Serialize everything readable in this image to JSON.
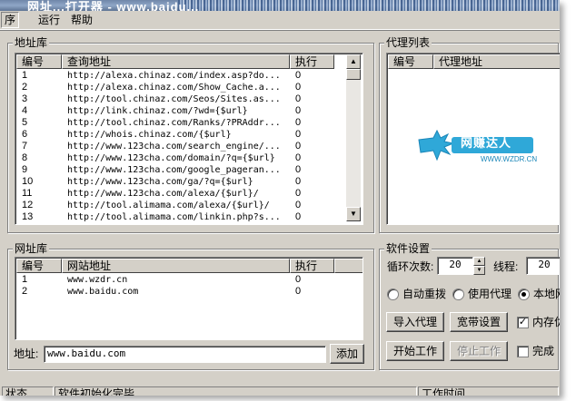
{
  "window": {
    "title": "网址...打开器 - www.baidu..."
  },
  "menu": [
    "序",
    "运行",
    "帮助"
  ],
  "address_library": {
    "group_label": "地址库",
    "columns": [
      "编号",
      "查询地址",
      "执行"
    ],
    "rows": [
      [
        "1",
        "http://alexa.chinaz.com/index.asp?do...",
        "0"
      ],
      [
        "2",
        "http://alexa.chinaz.com/Show_Cache.a...",
        "0"
      ],
      [
        "3",
        "http://tool.chinaz.com/Seos/Sites.as...",
        "0"
      ],
      [
        "4",
        "http://link.chinaz.com/?wd={$url}",
        "0"
      ],
      [
        "5",
        "http://tool.chinaz.com/Ranks/?PRAddr...",
        "0"
      ],
      [
        "6",
        "http://whois.chinaz.com/{$url}",
        "0"
      ],
      [
        "7",
        "http://www.123cha.com/search_engine/...",
        "0"
      ],
      [
        "8",
        "http://www.123cha.com/domain/?q={$url}",
        "0"
      ],
      [
        "9",
        "http://www.123cha.com/google_pageran...",
        "0"
      ],
      [
        "10",
        "http://www.123cha.com/ga/?q={$url}",
        "0"
      ],
      [
        "11",
        "http://www.123cha.com/alexa/{$url}/",
        "0"
      ],
      [
        "12",
        "http://tool.alimama.com/alexa/{$url}/",
        "0"
      ],
      [
        "13",
        "http://tool.alimama.com/linkin.php?s...",
        "0"
      ]
    ]
  },
  "proxy_list": {
    "group_label": "代理列表",
    "columns": [
      "编号",
      "代理地址"
    ],
    "logo_text": "网赚达人",
    "logo_sub": "WWW.WZDR.CN"
  },
  "url_library": {
    "group_label": "网址库",
    "columns": [
      "编号",
      "网站地址",
      "执行"
    ],
    "rows": [
      [
        "1",
        "www.wzdr.cn",
        "0"
      ],
      [
        "2",
        "www.baidu.com",
        "0"
      ]
    ],
    "address_label": "地址:",
    "address_value": "www.baidu.com",
    "add_button": "添加"
  },
  "settings": {
    "group_label": "软件设置",
    "loop_label": "循环次数:",
    "loop_value": "20",
    "thread_label": "线程:",
    "thread_value": "20",
    "radio_auto_redial": "自动重拨",
    "radio_use_proxy": "使用代理",
    "radio_local": "本地网",
    "selected_radio": "local",
    "import_proxy": "导入代理",
    "broadband_settings": "宽带设置",
    "memory_opt": "内存优化",
    "memory_opt_checked": true,
    "start_work": "开始工作",
    "stop_work": "停止工作",
    "complete_label": "完成",
    "complete_checked": false
  },
  "status": {
    "label": "状态",
    "message": "软件初始化完毕...",
    "work_time": "工作时间"
  }
}
